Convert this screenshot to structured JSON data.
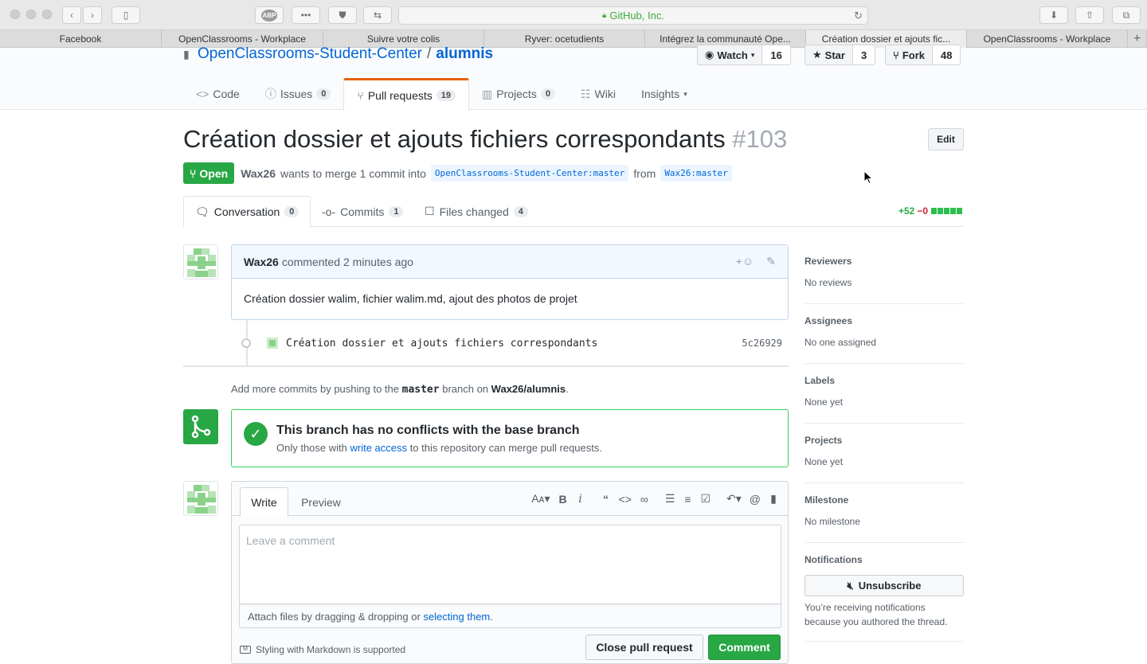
{
  "browser": {
    "url_label": "GitHub, Inc.",
    "abp_label": "ABP",
    "tabs": [
      "Facebook",
      "OpenClassrooms - Workplace",
      "Suivre votre colis",
      "Ryver: ocetudients",
      "Intégrez la communauté Ope...",
      "Création dossier et ajouts fic...",
      "OpenClassrooms - Workplace"
    ],
    "new_tab": "+"
  },
  "repo": {
    "owner": "OpenClassrooms-Student-Center",
    "separator": "/",
    "name": "alumnis",
    "watch_label": "Watch",
    "watch_count": "16",
    "star_label": "Star",
    "star_count": "3",
    "fork_label": "Fork",
    "fork_count": "48",
    "nav": [
      {
        "label": "Code",
        "count": ""
      },
      {
        "label": "Issues",
        "count": "0"
      },
      {
        "label": "Pull requests",
        "count": "19"
      },
      {
        "label": "Projects",
        "count": "0"
      },
      {
        "label": "Wiki",
        "count": ""
      },
      {
        "label": "Insights",
        "count": ""
      }
    ]
  },
  "pr": {
    "title": "Création dossier et ajouts fichiers correspondants",
    "number": "#103",
    "edit_label": "Edit",
    "status": "Open",
    "author": "Wax26",
    "merge_text": "wants to merge 1 commit into",
    "base_branch": "OpenClassrooms-Student-Center:master",
    "from_text": "from",
    "head_branch": "Wax26:master",
    "tabs": [
      {
        "label": "Conversation",
        "count": "0"
      },
      {
        "label": "Commits",
        "count": "1"
      },
      {
        "label": "Files changed",
        "count": "4"
      }
    ],
    "additions": "+52",
    "deletions": "−0"
  },
  "comment": {
    "author": "Wax26",
    "action": "commented",
    "time": "2 minutes ago",
    "body": "Création dossier walim, fichier walim.md, ajout des photos de projet"
  },
  "commit": {
    "message": "Création dossier et ajouts fichiers correspondants",
    "sha": "5c26929"
  },
  "add_more": {
    "prefix": "Add more commits by pushing to the",
    "branch": "master",
    "middle": "branch on",
    "repo": "Wax26/alumnis",
    "suffix": "."
  },
  "merge": {
    "title": "This branch has no conflicts with the base branch",
    "sub_prefix": "Only those with",
    "sub_link": "write access",
    "sub_suffix": "to this repository can merge pull requests."
  },
  "editor": {
    "tab_write": "Write",
    "tab_preview": "Preview",
    "placeholder": "Leave a comment",
    "attach_prefix": "Attach files by dragging & dropping or",
    "attach_link": "selecting them",
    "attach_suffix": ".",
    "markdown_note": "Styling with Markdown is supported",
    "close_label": "Close pull request",
    "comment_label": "Comment"
  },
  "sidebar": {
    "sections": [
      {
        "heading": "Reviewers",
        "value": "No reviews"
      },
      {
        "heading": "Assignees",
        "value": "No one assigned"
      },
      {
        "heading": "Labels",
        "value": "None yet"
      },
      {
        "heading": "Projects",
        "value": "None yet"
      },
      {
        "heading": "Milestone",
        "value": "No milestone"
      }
    ],
    "notifications_heading": "Notifications",
    "unsubscribe_label": "Unsubscribe",
    "notif_note": "You’re receiving notifications because you authored the thread."
  },
  "colors": {
    "accent": "#0366d6",
    "open_green": "#28a745",
    "tab_orange": "#e36209"
  }
}
